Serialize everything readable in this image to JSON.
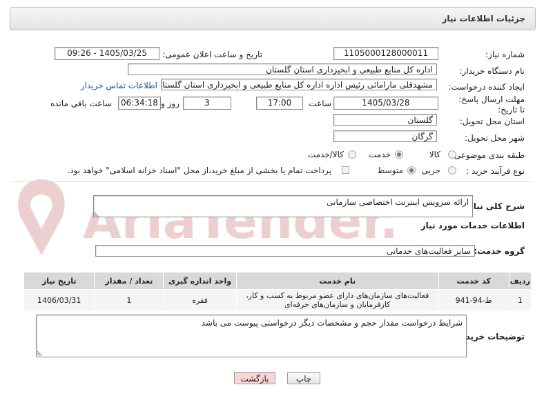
{
  "header": {
    "title": "جزئیات اطلاعات نیاز"
  },
  "form": {
    "need_number_label": "شماره نیاز:",
    "need_number": "1105000128000011",
    "announce_label": "تاریخ و ساعت اعلان عمومی:",
    "announce_value": "1405/03/25 - 09:26",
    "buyer_label": "نام دستگاه خریدار:",
    "buyer_value": "اداره کل منابع طبیعی و ابخیزداری استان گلستان",
    "creator_label": "ایجاد کننده درخواست:",
    "creator_value": "مشهدقلی مارامائی رئیس اداره اداره کل منابع طبیعی و ابخیزداری استان گلستان",
    "contact_link": "اطلاعات تماس خریدار",
    "deadline_label": "مهلت ارسال پاسخ: تا تاریخ:",
    "deadline_date": "1405/03/28",
    "time_label": "ساعت",
    "deadline_time": "17:00",
    "days_value": "3",
    "days_label": "روز و",
    "remaining_time": "06:34:18",
    "remaining_label": "ساعت باقی مانده",
    "province_label": "استان محل تحویل:",
    "province_value": "گلستان",
    "city_label": "شهر محل تحویل:",
    "city_value": "گرگان",
    "category_label": "طبقه بندی موضوعی:",
    "category_options": [
      "کالا",
      "خدمت",
      "کالا/خدمت"
    ],
    "category_selected": "خدمت",
    "process_label": "نوع فرآیند خرید :",
    "process_options": [
      "جزیی",
      "متوسط"
    ],
    "process_selected": "متوسط",
    "payment_note": "پرداخت تمام یا بخشی از مبلغ خرید،از محل \"اسناد خزانه اسلامی\" خواهد بود."
  },
  "summary": {
    "label": "شرح کلی نیاز:",
    "value": "ارائه سرویس اینترنت اختصاصی سازمانی"
  },
  "services": {
    "section_title": "اطلاعات خدمات مورد نیاز",
    "group_label": "گروه خدمت:",
    "group_value": "سایر فعالیت‌های خدماتی",
    "columns": [
      "ردیف",
      "کد خدمت",
      "نام خدمت",
      "واحد اندازه گیری",
      "تعداد / مقدار",
      "تاریخ نیاز"
    ],
    "rows": [
      {
        "index": "1",
        "code": "ط-94-941",
        "name": "فعالیت‌های سازمان‌های دارای عضو مربوط به کسب و کار، کارفرمایان و سازمان‌های حرفه‌ای",
        "unit": "فقره",
        "qty": "1",
        "date": "1406/03/31"
      }
    ]
  },
  "buyer_notes": {
    "label": "توضیحات خریدار:",
    "value": "شرایط درخواست مقدار حجم و مشخصات دیگر درخواستی پیوست می باشد"
  },
  "buttons": {
    "print": "چاپ",
    "back": "بازگشت"
  },
  "watermark": {
    "text": "AriaTender.neT"
  },
  "colors": {
    "link": "#1a4fb0",
    "watermark": "#e9c4c4",
    "back_button": "#f7d6d6"
  }
}
